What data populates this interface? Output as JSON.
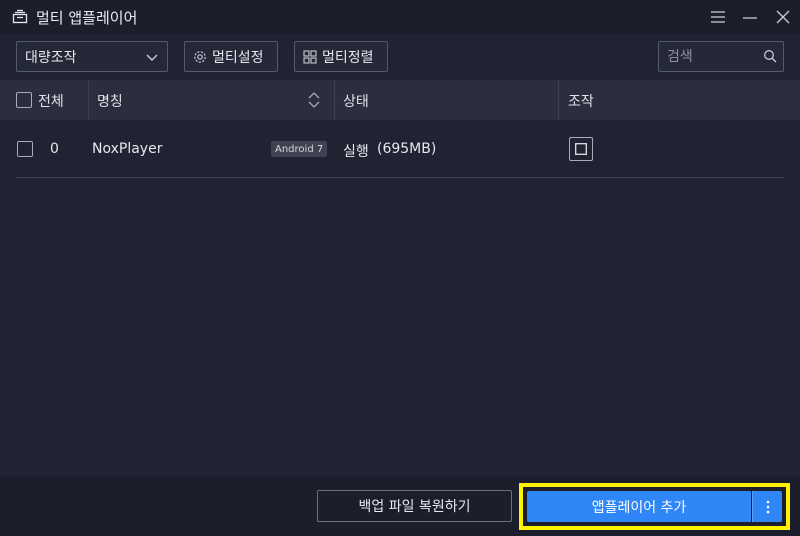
{
  "window": {
    "title": "멀티 앱플레이어",
    "icons": [
      "multi-window-icon",
      "menu-icon",
      "minimize-icon",
      "close-icon"
    ]
  },
  "toolbar": {
    "batch_select": "대량조작",
    "settings_label": "멀티설정",
    "arrange_label": "멀티정렬",
    "search_placeholder": "검색"
  },
  "table": {
    "headers": {
      "all": "전체",
      "name": "명칭",
      "status": "상태",
      "control": "조작"
    },
    "rows": [
      {
        "index": "0",
        "name": "NoxPlayer",
        "version": "Android 7",
        "status": "실행",
        "memory": "(695MB)"
      }
    ]
  },
  "footer": {
    "restore_label": "백업 파일 복원하기",
    "add_label": "앱플레이어 추가"
  },
  "colors": {
    "accent": "#2f86f6",
    "highlight": "#fff200",
    "background": "#202331"
  }
}
